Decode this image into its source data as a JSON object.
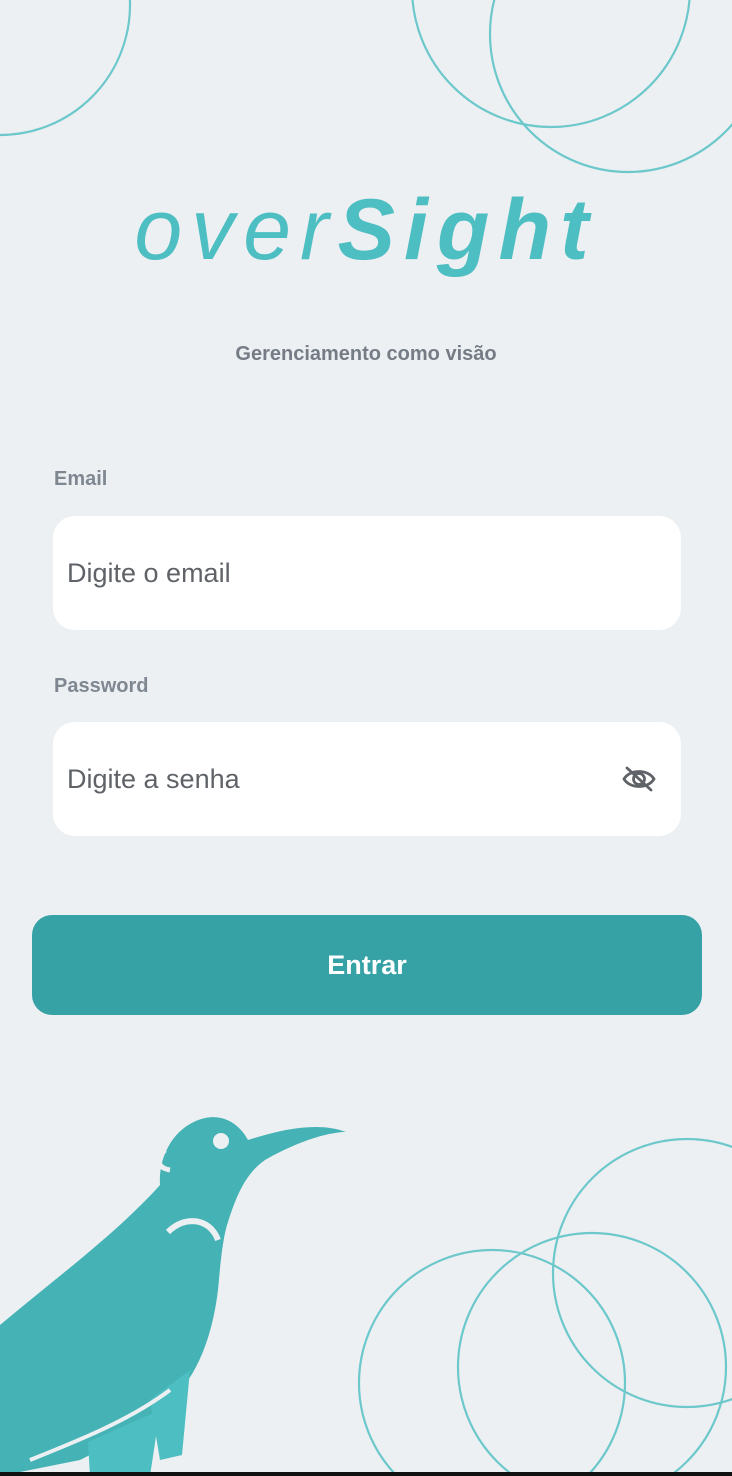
{
  "brand": {
    "logo_part1": "over",
    "logo_part2": "Sight",
    "tagline": "Gerenciamento como visão"
  },
  "login_form": {
    "email_label": "Email",
    "email_placeholder": "Digite o email",
    "email_value": "",
    "password_label": "Password",
    "password_placeholder": "Digite a senha",
    "password_value": "",
    "visibility_icon": "eye-off-icon",
    "submit_label": "Entrar"
  },
  "colors": {
    "accent": "#37a2a6",
    "logo": "#4dbec1",
    "background": "#edf0f3",
    "circle_stroke": "#5fc4c7"
  }
}
